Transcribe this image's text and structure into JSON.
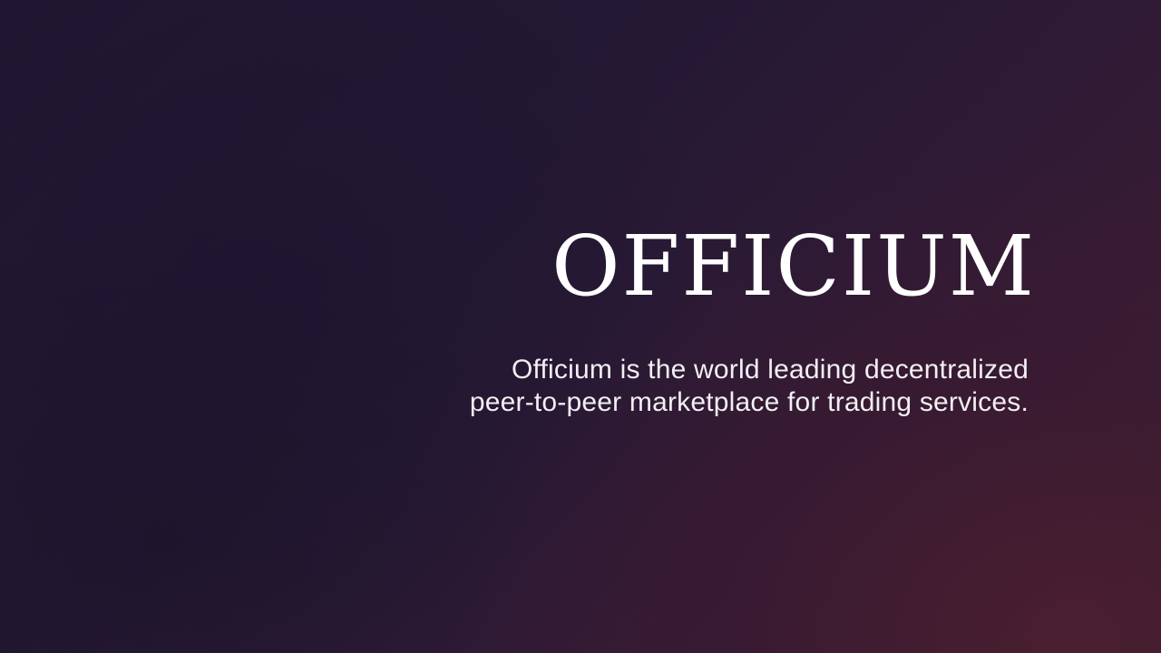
{
  "hero": {
    "brand": "OFFICIUM",
    "tagline_line1": "Officium is the world leading decentralized",
    "tagline_line2": "peer-to-peer marketplace for trading services."
  },
  "colors": {
    "background_dark": "#1f1731",
    "background_warm": "#42202e",
    "text": "#ffffff"
  }
}
